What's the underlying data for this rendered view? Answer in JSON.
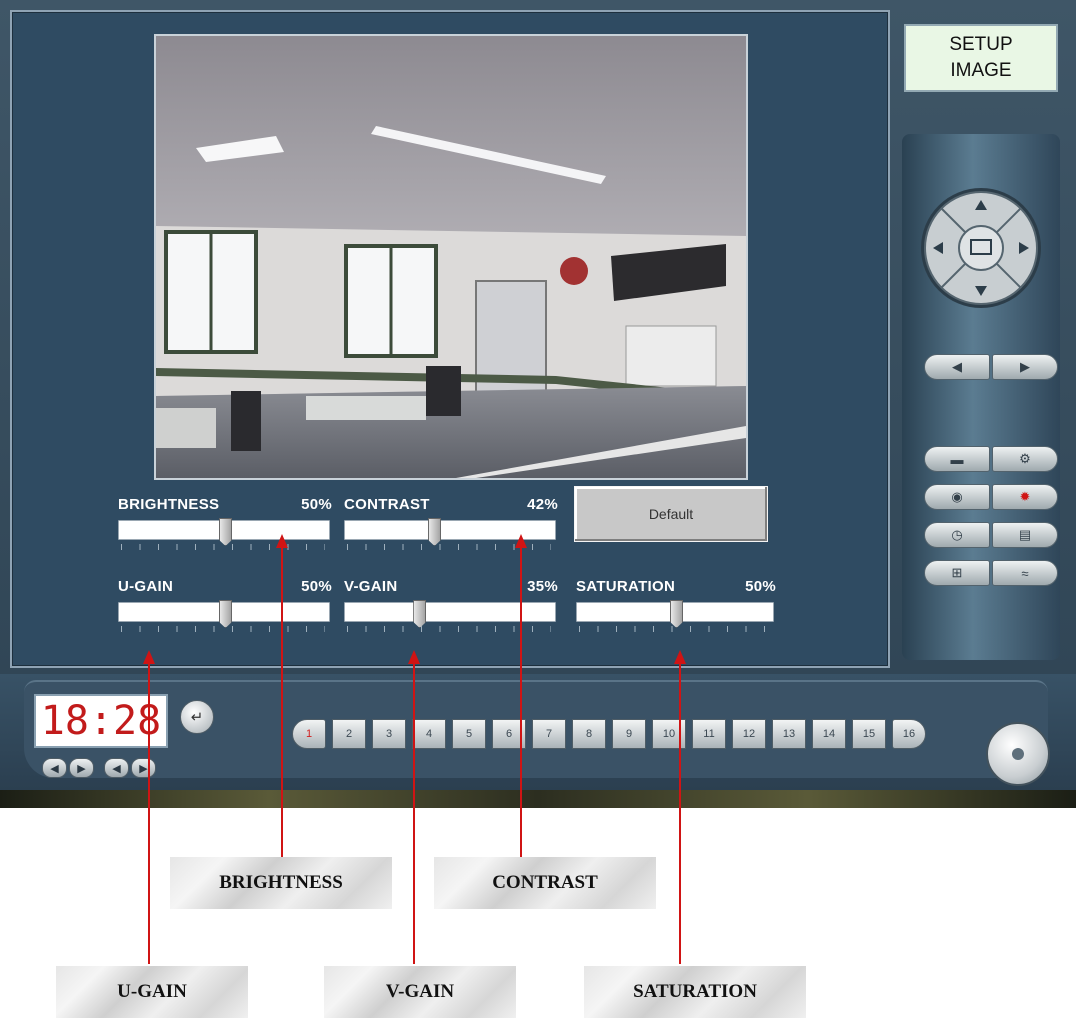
{
  "header": {
    "setup_line1": "SETUP",
    "setup_line2": "IMAGE"
  },
  "sliders": {
    "brightness": {
      "label": "BRIGHTNESS",
      "value": "50%",
      "level": 0.5
    },
    "contrast": {
      "label": "CONTRAST",
      "value": "42%",
      "level": 0.42
    },
    "ugain": {
      "label": "U-GAIN",
      "value": "50%",
      "level": 0.5
    },
    "vgain": {
      "label": "V-GAIN",
      "value": "35%",
      "level": 0.35
    },
    "saturation": {
      "label": "SATURATION",
      "value": "50%",
      "level": 0.5
    }
  },
  "default_button": {
    "label": "Default"
  },
  "clock": {
    "time": "18:28"
  },
  "channels": [
    "1",
    "2",
    "3",
    "4",
    "5",
    "6",
    "7",
    "8",
    "9",
    "10",
    "11",
    "12",
    "13",
    "14",
    "15",
    "16"
  ],
  "active_channel": "1",
  "callouts": {
    "brightness": "BRIGHTNESS",
    "contrast": "CONTRAST",
    "ugain": "U-GAIN",
    "vgain": "V-GAIN",
    "saturation": "SATURATION"
  },
  "icons": {
    "dpad": "directional-pad-icon",
    "camera_select": "camera-monitor-icon",
    "record": "record-icon",
    "settings": "settings-gear-icon",
    "alarm": "alarm-icon",
    "schedule": "clock-icon",
    "storage": "storage-icon",
    "network": "network-icon",
    "ptz": "ptz-camera-icon",
    "enter": "enter-icon",
    "power": "power-icon"
  },
  "colors": {
    "accent_red": "#d01414",
    "clock_red": "#c21b1b",
    "panel_blue": "#2f4b62",
    "label_green": "#e9f7e5"
  }
}
